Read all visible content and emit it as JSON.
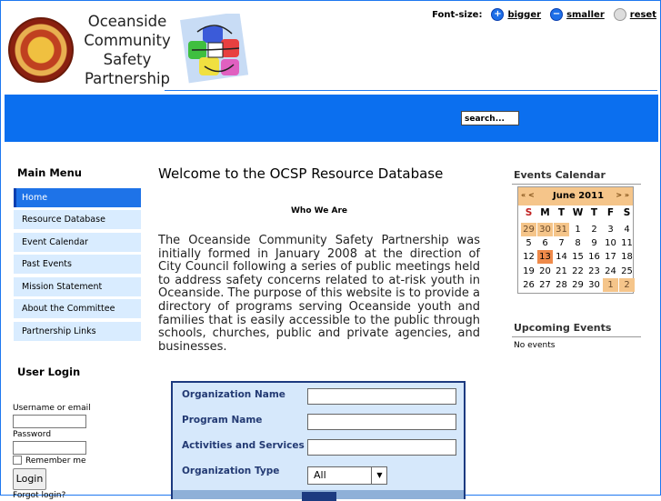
{
  "header": {
    "title_lines": [
      "Oceanside",
      "Community",
      "Safety",
      "Partnership"
    ],
    "font_size": {
      "label": "Font-size:",
      "bigger": "bigger",
      "smaller": "smaller",
      "reset": "reset"
    }
  },
  "banner": {
    "search_placeholder": "search..."
  },
  "main_menu": {
    "title": "Main Menu",
    "items": [
      {
        "label": "Home",
        "active": true
      },
      {
        "label": "Resource Database"
      },
      {
        "label": "Event Calendar"
      },
      {
        "label": "Past Events"
      },
      {
        "label": "Mission Statement"
      },
      {
        "label": "About the Committee"
      },
      {
        "label": "Partnership Links"
      }
    ]
  },
  "user_login": {
    "title": "User Login",
    "username_label": "Username or email",
    "password_label": "Password",
    "remember_label": "Remember me",
    "login_button": "Login",
    "forgot_label": "Forgot login?"
  },
  "content": {
    "heading": "Welcome to the OCSP Resource Database",
    "subheading": "Who We Are",
    "paragraph": "The Oceanside Community Safety Partnership was initially formed in January 2008 at the direction of City Council following a series of public meetings held to address safety concerns related to at-risk youth in Oceanside. The purpose of this website is to provide a directory of programs serving Oceanside youth and families that is easily accessible to the public through schools, churches, public and private agencies, and businesses."
  },
  "search_form": {
    "fields": [
      "Organization Name",
      "Program Name",
      "Activities and Services",
      "Organization Type"
    ],
    "organization_type_value": "All"
  },
  "events_calendar": {
    "title": "Events Calendar",
    "nav_prev": "« <",
    "nav_next": "> »",
    "month": "June 2011",
    "days_of_week": [
      "S",
      "M",
      "T",
      "W",
      "T",
      "F",
      "S"
    ],
    "weeks": [
      [
        "29",
        "30",
        "31",
        "1",
        "2",
        "3",
        "4"
      ],
      [
        "5",
        "6",
        "7",
        "8",
        "9",
        "10",
        "11"
      ],
      [
        "12",
        "13",
        "14",
        "15",
        "16",
        "17",
        "18"
      ],
      [
        "19",
        "20",
        "21",
        "22",
        "23",
        "24",
        "25"
      ],
      [
        "26",
        "27",
        "28",
        "29",
        "30",
        "1",
        "2"
      ]
    ],
    "today": "13"
  },
  "upcoming_events": {
    "title": "Upcoming Events",
    "empty_text": "No events"
  },
  "colors": {
    "brand_blue": "#0b6fef",
    "calendar_accent": "#f5c58a",
    "today": "#ef8a4a"
  }
}
